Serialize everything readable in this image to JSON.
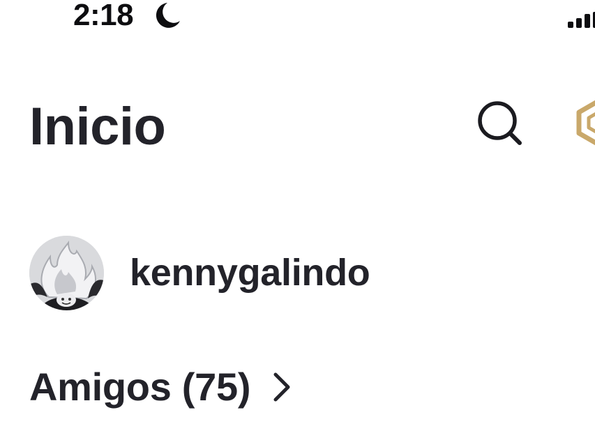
{
  "status_bar": {
    "time": "2:18",
    "moon_icon": "moon-icon",
    "signal_icon": "cellular-signal-icon"
  },
  "header": {
    "title": "Inicio",
    "search_icon": "search-icon",
    "robux_icon": "robux-icon"
  },
  "profile": {
    "username": "kennygalindo",
    "avatar_icon": "avatar"
  },
  "friends": {
    "label": "Amigos (75)",
    "chevron_icon": "chevron-right-icon"
  },
  "colors": {
    "text_primary": "#23232a",
    "background": "#ffffff",
    "robux_gold": "#c9a86a"
  }
}
